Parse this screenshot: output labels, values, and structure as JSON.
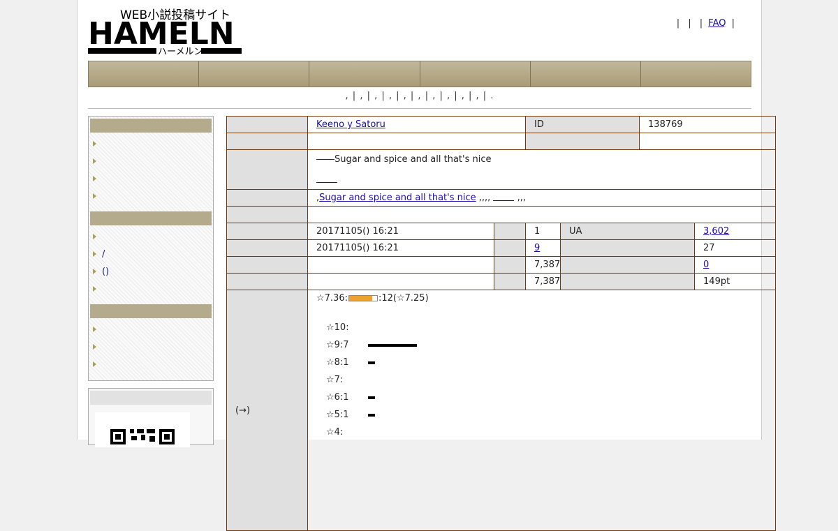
{
  "header": {
    "logo_tagline": "WEB小説投稿サイト",
    "logo_name": "HAMELN",
    "logo_kana": "ハーメルン",
    "top_links": [
      "|",
      "|",
      "|",
      "FAQ",
      "|"
    ]
  },
  "subnav": ", | , | , | , | , | , | , | , | , | , | .",
  "info": {
    "author": " Keeno y Satoru",
    "id_label": "ID",
    "id_value": "138769",
    "synopsis": "――Sugar and spice and all that's nice",
    "tags_main": "Sugar and spice and all that's nice",
    "tags_extra": ",,,,",
    "published": "20171105() 16:21",
    "updated": "20171105() 16:21",
    "episodes": "1",
    "ua_label": "UA",
    "ua_value": "3,602",
    "favorites": "9",
    "favorites_right": "27",
    "chars": "7,387",
    "reviews": "0",
    "chars_total": "7,387",
    "points": "149pt",
    "rating_label": "(→)",
    "rating_summary_a": "☆7.36:",
    "rating_summary_b": ":12(☆7.25)",
    "rating_fill": 0.82,
    "distribution": [
      {
        "label": "☆10:",
        "count": 0
      },
      {
        "label": "☆9:7",
        "count": 7
      },
      {
        "label": "☆8:1",
        "count": 1
      },
      {
        "label": "☆7:",
        "count": 0
      },
      {
        "label": "☆6:1",
        "count": 1
      },
      {
        "label": "☆5:1",
        "count": 1
      },
      {
        "label": "☆4:",
        "count": 0
      }
    ]
  },
  "sidebar": {
    "group2_items": [
      "/",
      "()"
    ]
  }
}
